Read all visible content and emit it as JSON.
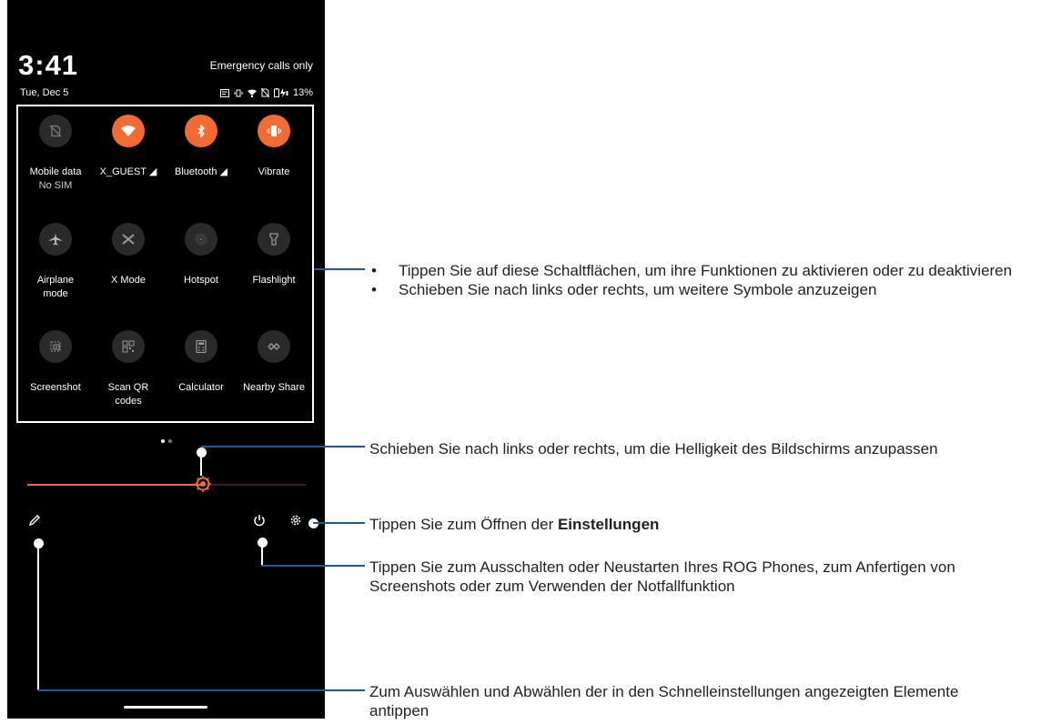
{
  "phone": {
    "time": "3:41",
    "date": "Tue, Dec 5",
    "carrier": "Emergency calls only",
    "status_icons": [
      "data-saver-icon",
      "vibrate-status-icon",
      "wifi-status-icon",
      "no-sim-icon",
      "battery-charging-icon"
    ],
    "battery": "13%"
  },
  "tiles": [
    {
      "label": "Mobile data",
      "sub": "No SIM",
      "icon": "no-sim-icon",
      "active": false
    },
    {
      "label": "X_GUEST ◢",
      "sub": "",
      "icon": "wifi-icon",
      "active": true
    },
    {
      "label": "Bluetooth ◢",
      "sub": "",
      "icon": "bluetooth-icon",
      "active": true
    },
    {
      "label": "Vibrate",
      "sub": "",
      "icon": "vibrate-icon",
      "active": true
    },
    {
      "label": "Airplane mode",
      "sub": "",
      "icon": "airplane-icon",
      "active": false
    },
    {
      "label": "X Mode",
      "sub": "",
      "icon": "x-mode-icon",
      "active": false
    },
    {
      "label": "Hotspot",
      "sub": "",
      "icon": "hotspot-icon",
      "active": false
    },
    {
      "label": "Flashlight",
      "sub": "",
      "icon": "flashlight-icon",
      "active": false
    },
    {
      "label": "Screenshot",
      "sub": "",
      "icon": "screenshot-icon",
      "active": false
    },
    {
      "label": "Scan QR codes",
      "sub": "",
      "icon": "qr-code-icon",
      "active": false
    },
    {
      "label": "Calculator",
      "sub": "",
      "icon": "calculator-icon",
      "active": false
    },
    {
      "label": "Nearby Share",
      "sub": "",
      "icon": "nearby-share-icon",
      "active": false
    }
  ],
  "brightness": {
    "level": 0.63
  },
  "colors": {
    "accent": "#f26a34",
    "callout_line": "#1a5a9c"
  },
  "callouts": {
    "tiles_bullets": [
      "Tippen Sie auf diese Schaltflächen, um ihre Funktionen zu aktivieren oder zu deaktivieren",
      "Schieben Sie nach links oder rechts, um weitere Symbole anzuzeigen"
    ],
    "brightness": "Schieben Sie nach links oder rechts, um die Helligkeit des Bildschirms anzupassen",
    "settings_prefix": "Tippen Sie zum Öffnen der ",
    "settings_bold": "Einstellungen",
    "power": "Tippen Sie zum Ausschalten oder Neustarten Ihres ROG Phones, zum Anfertigen von Screenshots oder zum Verwenden der Notfallfunktion",
    "edit": "Zum Auswählen und Abwählen der in den Schnelleinstellungen angezeigten Elemente antippen"
  }
}
